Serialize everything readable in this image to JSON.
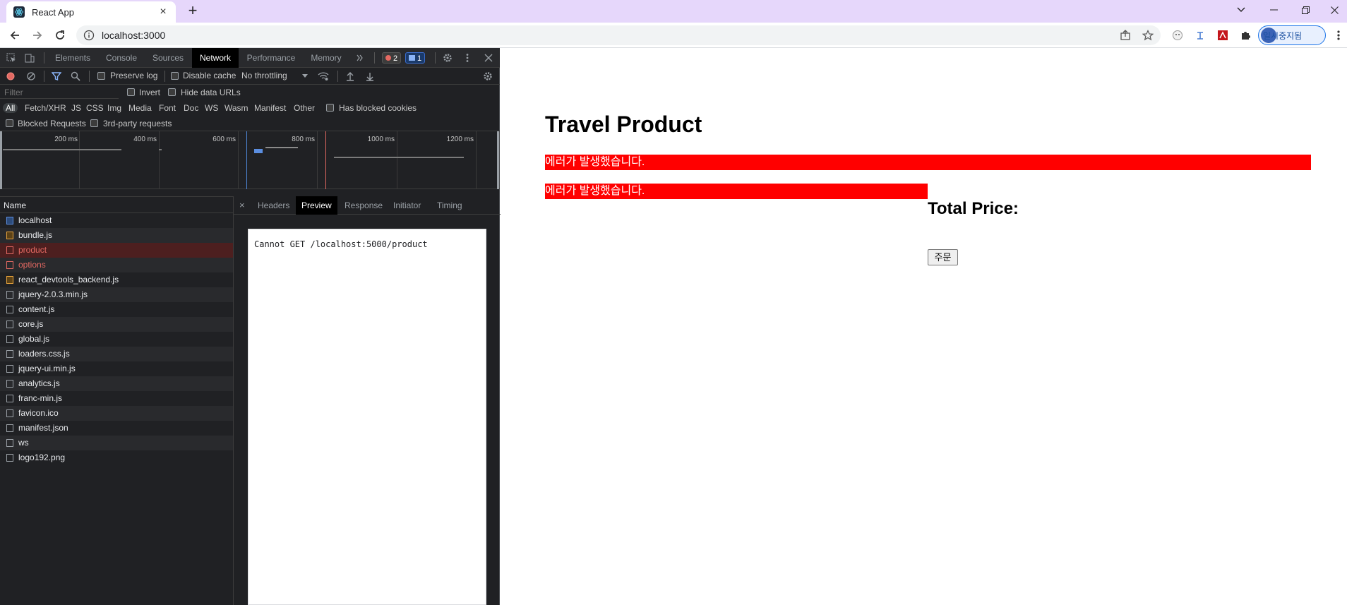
{
  "browser": {
    "tab_title": "React App",
    "url": "localhost:3000",
    "profile_label": "일시중지됨"
  },
  "devtools": {
    "tabs": [
      "Elements",
      "Console",
      "Sources",
      "Network",
      "Performance",
      "Memory"
    ],
    "active_tab": "Network",
    "error_count": "2",
    "message_count": "1",
    "toolbar": {
      "preserve_log": "Preserve log",
      "disable_cache": "Disable cache",
      "throttling": "No throttling"
    },
    "filter": {
      "placeholder": "Filter",
      "invert": "Invert",
      "hide_data_urls": "Hide data URLs",
      "has_blocked_cookies": "Has blocked cookies",
      "blocked_requests": "Blocked Requests",
      "third_party": "3rd-party requests",
      "types": [
        "All",
        "Fetch/XHR",
        "JS",
        "CSS",
        "Img",
        "Media",
        "Font",
        "Doc",
        "WS",
        "Wasm",
        "Manifest",
        "Other"
      ]
    },
    "timeline_ticks": [
      "200 ms",
      "400 ms",
      "600 ms",
      "800 ms",
      "1000 ms",
      "1200 ms"
    ],
    "name_header": "Name",
    "requests": [
      {
        "name": "localhost",
        "status": "ok",
        "type": "doc"
      },
      {
        "name": "bundle.js",
        "status": "ok",
        "type": "js"
      },
      {
        "name": "product",
        "status": "error",
        "type": "other",
        "selected": true
      },
      {
        "name": "options",
        "status": "error",
        "type": "other"
      },
      {
        "name": "react_devtools_backend.js",
        "status": "ok",
        "type": "js"
      },
      {
        "name": "jquery-2.0.3.min.js",
        "status": "ok",
        "type": "other"
      },
      {
        "name": "content.js",
        "status": "ok",
        "type": "other"
      },
      {
        "name": "core.js",
        "status": "ok",
        "type": "other"
      },
      {
        "name": "global.js",
        "status": "ok",
        "type": "other"
      },
      {
        "name": "loaders.css.js",
        "status": "ok",
        "type": "other"
      },
      {
        "name": "jquery-ui.min.js",
        "status": "ok",
        "type": "other"
      },
      {
        "name": "analytics.js",
        "status": "ok",
        "type": "other"
      },
      {
        "name": "franc-min.js",
        "status": "ok",
        "type": "other"
      },
      {
        "name": "favicon.ico",
        "status": "ok",
        "type": "other"
      },
      {
        "name": "manifest.json",
        "status": "ok",
        "type": "other"
      },
      {
        "name": "ws",
        "status": "ok",
        "type": "other"
      },
      {
        "name": "logo192.png",
        "status": "ok",
        "type": "other"
      }
    ],
    "detail_tabs": [
      "Headers",
      "Preview",
      "Response",
      "Initiator",
      "Timing"
    ],
    "active_detail_tab": "Preview",
    "preview_text": "Cannot GET /localhost:5000/product"
  },
  "page": {
    "heading": "Travel Product",
    "error_1": "에러가 발생했습니다.",
    "error_2": "에러가 발생했습니다.",
    "total_price_label": "Total Price:",
    "order_button": "주문"
  },
  "colors": {
    "titlebar": "#e6d7fb",
    "error_bg": "#ff0000",
    "devtools_bg": "#202124",
    "selected_row": "#4d1f1f",
    "error_text": "#e46962"
  }
}
